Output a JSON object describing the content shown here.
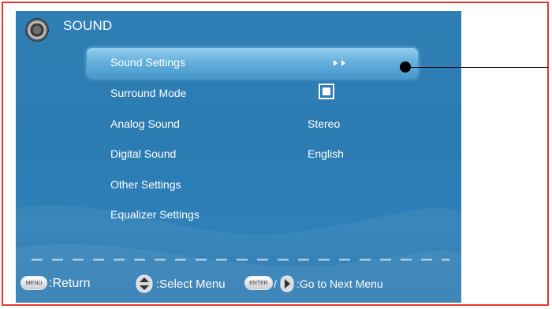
{
  "header": {
    "title": "SOUND",
    "icon": "speaker-icon"
  },
  "menu": {
    "items": [
      {
        "label": "Sound Settings",
        "value": "",
        "selected": true
      },
      {
        "label": "Surround Mode",
        "value": "",
        "checkbox": true
      },
      {
        "label": "Analog Sound",
        "value": "Stereo"
      },
      {
        "label": "Digital Sound",
        "value": "English"
      },
      {
        "label": "Other Settings",
        "value": ""
      },
      {
        "label": "Equalizer Settings",
        "value": ""
      }
    ]
  },
  "footer": {
    "menu_key": "MENU",
    "return_text": ":Return",
    "select_text": ":Select Menu",
    "enter_key": "ENTER",
    "slash": "/",
    "next_text": ":Go to Next Menu"
  },
  "colors": {
    "border": "#e8352c",
    "screen": "#2e7db4",
    "highlight": "#8ecdef"
  }
}
